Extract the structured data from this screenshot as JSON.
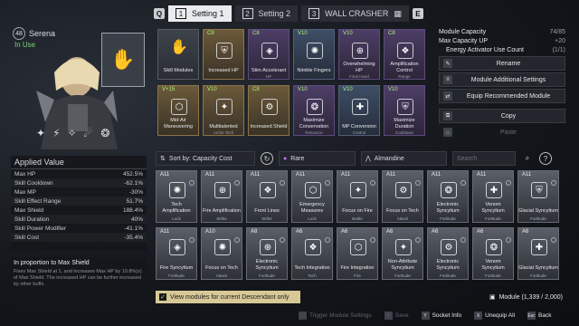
{
  "tabs": {
    "prev_key": "Q",
    "next_key": "E",
    "t1_num": "1",
    "t1": "Setting 1",
    "t2_num": "2",
    "t2": "Setting 2",
    "t3_num": "3",
    "t3": "WALL CRASHER"
  },
  "character": {
    "level": "48",
    "name": "Serena",
    "status": "In Use"
  },
  "capacity": {
    "module_capacity_label": "Module Capacity",
    "module_capacity_value": "74/85",
    "max_capacity_up_label": "Max Capacity UP",
    "max_capacity_up_value": "+20",
    "activator_label": "Energy Activator Use Count",
    "activator_value": "(1/1)"
  },
  "actions": [
    "Rename",
    "Module Additional Settings",
    "Equip Recommended Module",
    "Copy",
    "Paste"
  ],
  "applied": {
    "title": "Applied Value",
    "stats": [
      [
        "Max HP",
        "452.5%"
      ],
      [
        "Skill Cooldown",
        "-62.1%"
      ],
      [
        "Max MP",
        "-30%"
      ],
      [
        "Skill Effect Range",
        "51.7%"
      ],
      [
        "Max Shield",
        "188.4%"
      ],
      [
        "Skill Duration",
        "40%"
      ],
      [
        "Skill Power Modifier",
        "-41.1%"
      ],
      [
        "Skill Cost",
        "-35.4%"
      ]
    ]
  },
  "proportion": {
    "title": "In proportion to Max Shield",
    "text": "Fixes Max Shield at 1, and increases Max HP by 10.8%(x) of Max Shield. The increased HP can be further increased by other buffs."
  },
  "equipped": [
    {
      "name": "Skill Modules",
      "cap": "",
      "cap2": "",
      "sub": "",
      "style": "empty"
    },
    {
      "name": "Increased HP",
      "cap": "C8",
      "cap2": "",
      "sub": "",
      "style": "gold"
    },
    {
      "name": "Stim Accelerant",
      "cap": "C8",
      "cap2": "",
      "sub": "HP",
      "style": "purple"
    },
    {
      "name": "Nimble Fingers",
      "cap": "V10",
      "cap2": "",
      "sub": "",
      "style": "blue"
    },
    {
      "name": "Overwhelming HP",
      "cap": "V10",
      "cap2": "",
      "sub": "Final Hand",
      "style": "purple"
    },
    {
      "name": "Amplification Control",
      "cap": "C8",
      "cap2": "",
      "sub": "Range",
      "style": "purple"
    },
    {
      "name": "Mid-Air Maneuvering",
      "cap": "V+15",
      "cap2": "",
      "sub": "",
      "style": "gold"
    },
    {
      "name": "Multitalented",
      "cap": "V10",
      "cap2": "",
      "sub": "Arche Tech",
      "style": "gold"
    },
    {
      "name": "Increased Shield",
      "cap": "C8",
      "cap2": "",
      "sub": "",
      "style": "gold"
    },
    {
      "name": "Maximize Conservation",
      "cap": "V10",
      "cap2": "",
      "sub": "Resource",
      "style": "purple"
    },
    {
      "name": "MP Conversion",
      "cap": "V10",
      "cap2": "",
      "sub": "Control",
      "style": "blue"
    },
    {
      "name": "Maximize Duration",
      "cap": "V10",
      "cap2": "",
      "sub": "Cooldown",
      "style": "purple"
    }
  ],
  "filters": {
    "sort": "Sort by: Capacity Cost",
    "rarity": "Rare",
    "socket": "Almandine",
    "search_placeholder": "Search"
  },
  "modules": [
    {
      "name": "Tech Amplification",
      "cap": "A11",
      "sub": "Luck"
    },
    {
      "name": "Fire Amplification",
      "cap": "A11",
      "sub": "Strike"
    },
    {
      "name": "Front Lines",
      "cap": "A11",
      "sub": "Strike"
    },
    {
      "name": "Emergency Measures",
      "cap": "A11",
      "sub": "Luck"
    },
    {
      "name": "Focus on Fire",
      "cap": "A11",
      "sub": "Battle"
    },
    {
      "name": "Focus on Tech",
      "cap": "A11",
      "sub": "Attack"
    },
    {
      "name": "Electronic Syncytium",
      "cap": "A11",
      "sub": "Fortitude"
    },
    {
      "name": "Venom Syncytium",
      "cap": "A11",
      "sub": "Fortitude"
    },
    {
      "name": "Glacial Syncytium",
      "cap": "A11",
      "sub": "Fortitude"
    },
    {
      "name": "Fire Syncytium",
      "cap": "A11",
      "sub": "Fortitude"
    },
    {
      "name": "Focus on Tech",
      "cap": "A10",
      "sub": "Attack"
    },
    {
      "name": "Electronic Syncytium",
      "cap": "A8",
      "sub": "Fortitude"
    },
    {
      "name": "Tech Integration",
      "cap": "A6",
      "sub": "Tech"
    },
    {
      "name": "Fire Integration",
      "cap": "A6",
      "sub": "Fire"
    },
    {
      "name": "Non-Attribute Syncytium",
      "cap": "A6",
      "sub": "Fortitude"
    },
    {
      "name": "Electronic Syncytium",
      "cap": "A6",
      "sub": "Fortitude"
    },
    {
      "name": "Venom Syncytium",
      "cap": "A6",
      "sub": "Fortitude"
    },
    {
      "name": "Glacial Syncytium",
      "cap": "A6",
      "sub": "Fortitude"
    }
  ],
  "view_toggle": "View modules for current Descendant only",
  "module_count": "Module (1,339 / 2,000)",
  "footer": {
    "trigger": "Trigger Module Settings",
    "save": "Save",
    "socket": "Socket Info",
    "unequip": "Unequip All",
    "back": "Back",
    "k_save": "F",
    "k_socket": "Y",
    "k_unequip": "X",
    "k_back": "Esc"
  }
}
